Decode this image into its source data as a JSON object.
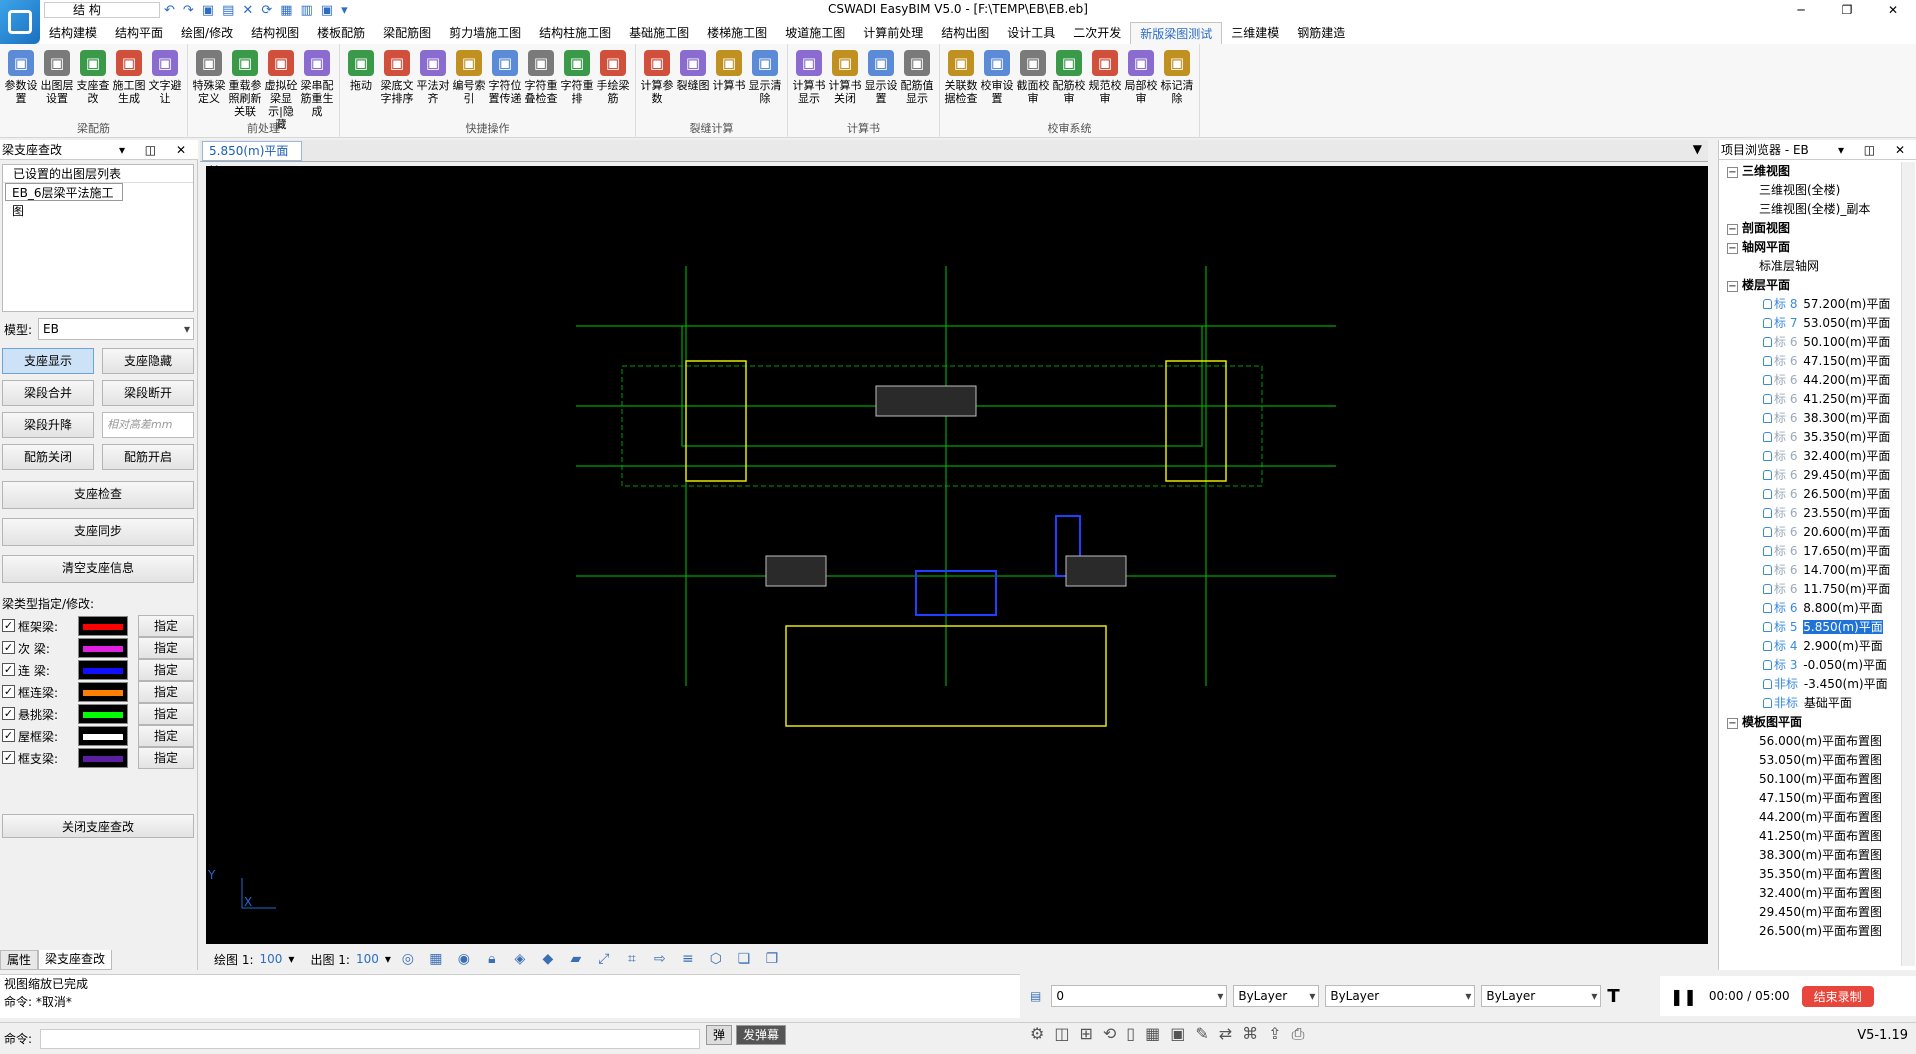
{
  "app": {
    "title": "CSWADI EasyBIM V5.0 - [F:\\TEMP\\EB\\EB.eb]",
    "profile": "结 构",
    "version": "V5-1.19"
  },
  "menu": [
    "结构建模",
    "结构平面",
    "绘图/修改",
    "结构视图",
    "楼板配筋",
    "梁配筋图",
    "剪力墙施工图",
    "结构柱施工图",
    "基础施工图",
    "楼梯施工图",
    "坡道施工图",
    "计算前处理",
    "结构出图",
    "设计工具",
    "二次开发",
    "新版梁图测试",
    "三维建模",
    "钢筋建造"
  ],
  "ribbon": {
    "groups": [
      {
        "title": "梁配筋",
        "buttons": [
          "参数设置",
          "出图层设置",
          "支座查改",
          "施工图生成",
          "文字避让"
        ]
      },
      {
        "title": "前处理",
        "buttons": [
          "特殊梁定义",
          "重载参照刷新关联",
          "虚拟砼梁显示|隐藏",
          "梁串配筋重生成"
        ]
      },
      {
        "title": "快捷操作",
        "buttons": [
          "拖动",
          "梁底文字排序",
          "平法对齐",
          "编号索引",
          "字符位置传递",
          "字符重叠检查",
          "字符重排",
          "手绘梁筋"
        ]
      },
      {
        "title": "裂缝计算",
        "buttons": [
          "计算参数",
          "裂缝图",
          "计算书",
          "显示清除"
        ]
      },
      {
        "title": "计算书",
        "buttons": [
          "计算书显示",
          "计算书关闭",
          "显示设置",
          "配筋值显示"
        ]
      },
      {
        "title": "校审系统",
        "buttons": [
          "关联数据检查",
          "校审设置",
          "截面校审",
          "配筋校审",
          "规范校审",
          "局部校审",
          "标记清除"
        ]
      }
    ]
  },
  "left_panel": {
    "title": "梁支座查改",
    "layer_list_header": "已设置的出图层列表",
    "layer_item": "EB_6层梁平法施工图",
    "model_label": "模型:",
    "model_value": "EB",
    "buttons": {
      "show": "支座显示",
      "hide": "支座隐藏",
      "merge": "梁段合并",
      "split": "梁段断开",
      "lift": "梁段升降",
      "lift_placeholder": "相对高差mm",
      "rebar_off": "配筋关闭",
      "rebar_on": "配筋开启",
      "check": "支座检查",
      "sync": "支座同步",
      "clear": "清空支座信息",
      "close": "关闭支座查改"
    },
    "beam_type_label": "梁类型指定/修改:",
    "assign_label": "指定",
    "beam_types": [
      {
        "name": "框架梁:",
        "color": "#ff0000"
      },
      {
        "name": "次  梁:",
        "color": "#e020e0"
      },
      {
        "name": "连  梁:",
        "color": "#1010ff"
      },
      {
        "name": "框连梁:",
        "color": "#ff8000"
      },
      {
        "name": "悬挑梁:",
        "color": "#00ff00"
      },
      {
        "name": "屋框梁:",
        "color": "#ffffff"
      },
      {
        "name": "框支梁:",
        "color": "#5a1ea0"
      }
    ],
    "tabs": [
      "属性",
      "梁支座查改"
    ]
  },
  "doc_tab": "5.850(m)平面",
  "status": {
    "draw_label": "绘图 1:",
    "draw_scale": "100",
    "out_label": "出图 1:",
    "out_scale": "100"
  },
  "right_panel": {
    "title": "项目浏览器 - EB",
    "tree": [
      {
        "t": "cat",
        "label": "三维视图"
      },
      {
        "t": "item",
        "label": "三维视图(全楼)"
      },
      {
        "t": "item",
        "label": "三维视图(全楼)_副本"
      },
      {
        "t": "cat",
        "label": "剖面视图"
      },
      {
        "t": "cat",
        "label": "轴网平面"
      },
      {
        "t": "item",
        "label": "标准层轴网"
      },
      {
        "t": "cat",
        "label": "楼层平面"
      },
      {
        "t": "floor",
        "tag": "标 8",
        "label": "57.200(m)平面"
      },
      {
        "t": "floor",
        "tag": "标 7",
        "label": "53.050(m)平面"
      },
      {
        "t": "floor",
        "tag": "标 6",
        "label": "50.100(m)平面",
        "g": 1
      },
      {
        "t": "floor",
        "tag": "标 6",
        "label": "47.150(m)平面",
        "g": 1
      },
      {
        "t": "floor",
        "tag": "标 6",
        "label": "44.200(m)平面",
        "g": 1
      },
      {
        "t": "floor",
        "tag": "标 6",
        "label": "41.250(m)平面",
        "g": 1
      },
      {
        "t": "floor",
        "tag": "标 6",
        "label": "38.300(m)平面",
        "g": 1
      },
      {
        "t": "floor",
        "tag": "标 6",
        "label": "35.350(m)平面",
        "g": 1
      },
      {
        "t": "floor",
        "tag": "标 6",
        "label": "32.400(m)平面",
        "g": 1
      },
      {
        "t": "floor",
        "tag": "标 6",
        "label": "29.450(m)平面",
        "g": 1
      },
      {
        "t": "floor",
        "tag": "标 6",
        "label": "26.500(m)平面",
        "g": 1
      },
      {
        "t": "floor",
        "tag": "标 6",
        "label": "23.550(m)平面",
        "g": 1
      },
      {
        "t": "floor",
        "tag": "标 6",
        "label": "20.600(m)平面",
        "g": 1
      },
      {
        "t": "floor",
        "tag": "标 6",
        "label": "17.650(m)平面",
        "g": 1
      },
      {
        "t": "floor",
        "tag": "标 6",
        "label": "14.700(m)平面",
        "g": 1
      },
      {
        "t": "floor",
        "tag": "标 6",
        "label": "11.750(m)平面",
        "g": 1
      },
      {
        "t": "floor",
        "tag": "标 6",
        "label": "8.800(m)平面"
      },
      {
        "t": "floor",
        "tag": "标 5",
        "label": "5.850(m)平面",
        "hl": 1
      },
      {
        "t": "floor",
        "tag": "标 4",
        "label": "2.900(m)平面"
      },
      {
        "t": "floor",
        "tag": "标 3",
        "label": "-0.050(m)平面"
      },
      {
        "t": "floor",
        "tag": "非标",
        "label": "-3.450(m)平面"
      },
      {
        "t": "floor",
        "tag": "非标",
        "label": "基础平面"
      },
      {
        "t": "cat",
        "label": "模板图平面"
      },
      {
        "t": "item",
        "label": "56.000(m)平面布置图"
      },
      {
        "t": "item",
        "label": "53.050(m)平面布置图"
      },
      {
        "t": "item",
        "label": "50.100(m)平面布置图"
      },
      {
        "t": "item",
        "label": "47.150(m)平面布置图"
      },
      {
        "t": "item",
        "label": "44.200(m)平面布置图"
      },
      {
        "t": "item",
        "label": "41.250(m)平面布置图"
      },
      {
        "t": "item",
        "label": "38.300(m)平面布置图"
      },
      {
        "t": "item",
        "label": "35.350(m)平面布置图"
      },
      {
        "t": "item",
        "label": "32.400(m)平面布置图"
      },
      {
        "t": "item",
        "label": "29.450(m)平面布置图"
      },
      {
        "t": "item",
        "label": "26.500(m)平面布置图"
      }
    ]
  },
  "command": {
    "line1": "视图缩放已完成",
    "line2": "命令: *取消*",
    "prompt": "命令:"
  },
  "props": {
    "layer": "0",
    "color": "ByLayer",
    "linetype": "ByLayer",
    "lineweight": "ByLayer"
  },
  "recorder": {
    "time": "00:00 / 05:00",
    "stop": "结束录制"
  },
  "toggles": [
    "弹",
    "发弹幕"
  ]
}
